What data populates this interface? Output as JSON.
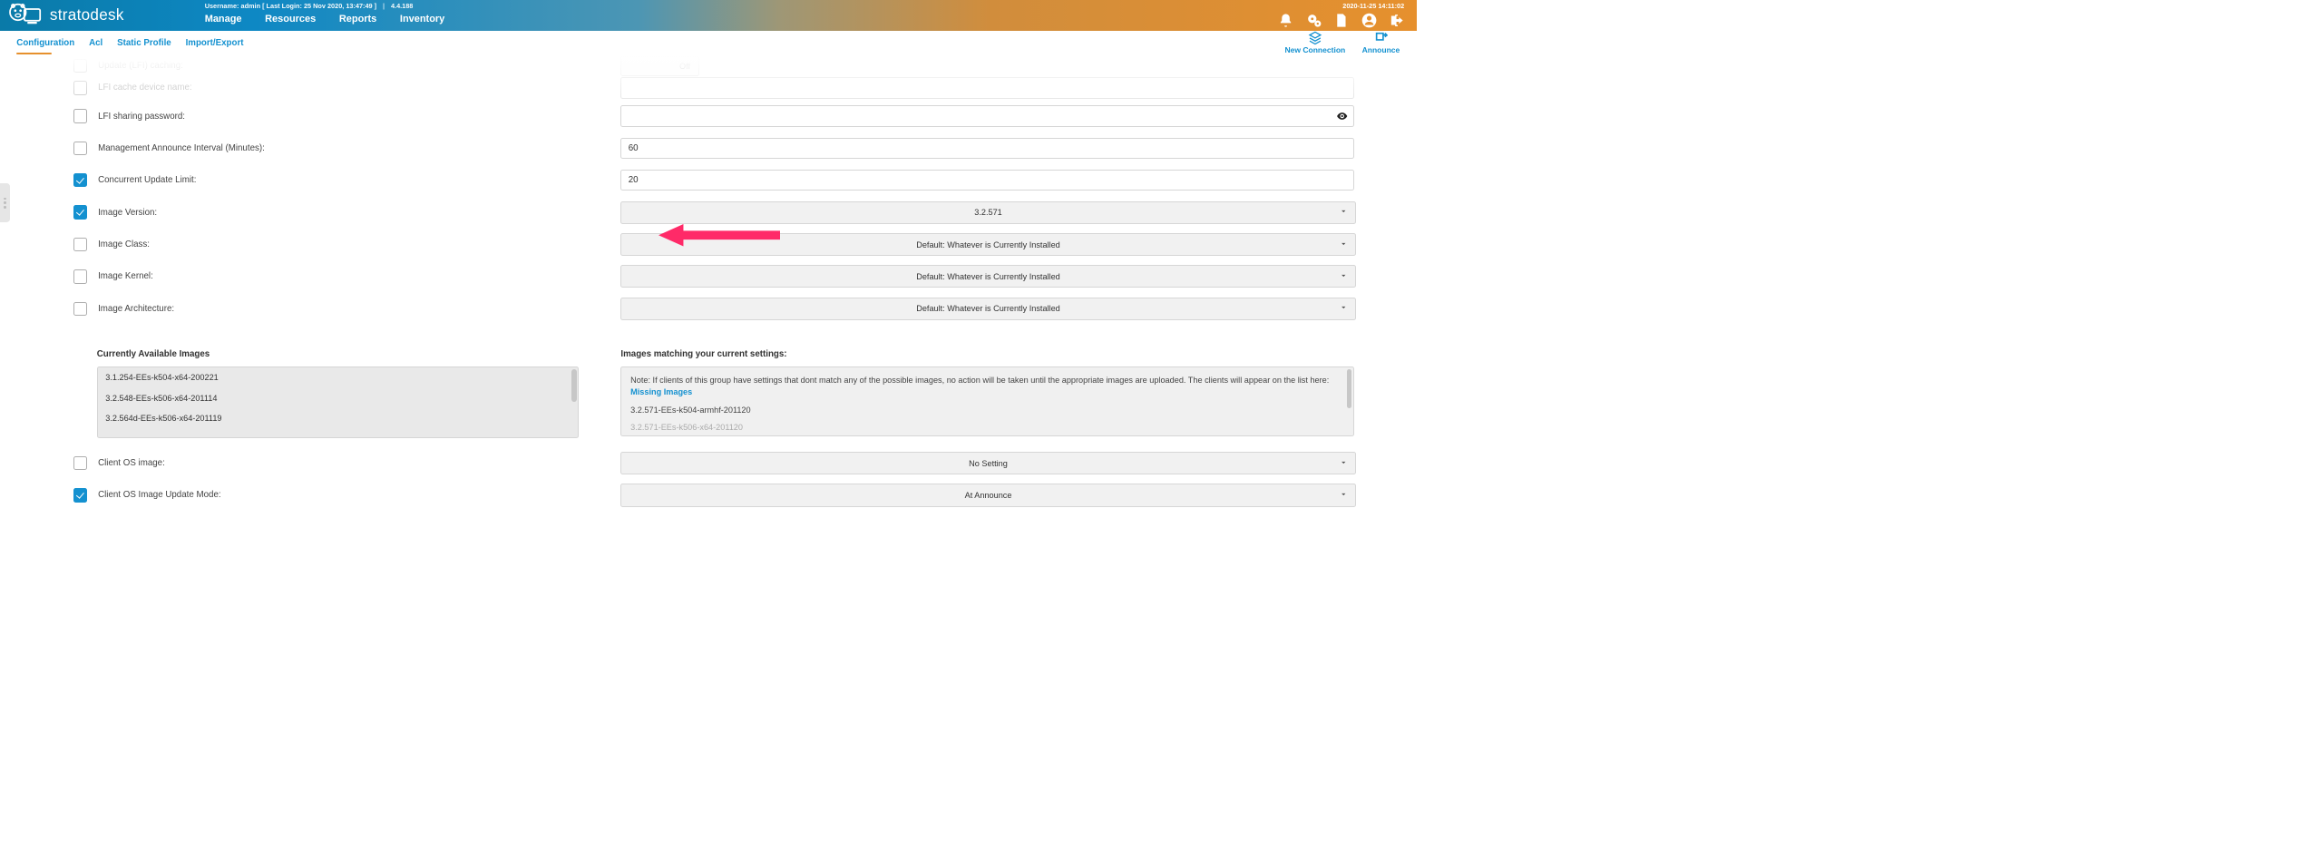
{
  "header": {
    "brand": "stratodesk",
    "username_line": "Username: admin [ Last Login: 25 Nov 2020, 13:47:49 ]",
    "version": "4.4.188",
    "clock": "2020-11-25 14:11:02",
    "nav": {
      "manage": "Manage",
      "resources": "Resources",
      "reports": "Reports",
      "inventory": "Inventory"
    }
  },
  "tabs": {
    "configuration": "Configuration",
    "acl": "Acl",
    "static_profile": "Static Profile",
    "import_export": "Import/Export",
    "new_connection": "New Connection",
    "announce": "Announce"
  },
  "form": {
    "lfi_caching": {
      "label": "Update (LFI) caching:",
      "toggle": "Off"
    },
    "lfi_cache_name": {
      "label": "LFI cache device name:"
    },
    "lfi_password": {
      "label": "LFI sharing password:"
    },
    "announce_interval": {
      "label": "Management Announce Interval (Minutes):",
      "value": "60"
    },
    "concurrent": {
      "label": "Concurrent Update Limit:",
      "value": "20"
    },
    "image_version": {
      "label": "Image Version:",
      "value": "3.2.571"
    },
    "image_class": {
      "label": "Image Class:",
      "value": "Default: Whatever is Currently Installed"
    },
    "image_kernel": {
      "label": "Image Kernel:",
      "value": "Default: Whatever is Currently Installed"
    },
    "image_arch": {
      "label": "Image Architecture:",
      "value": "Default: Whatever is Currently Installed"
    },
    "avail_title": "Currently Available Images",
    "avail_images": [
      "3.1.254-EEs-k504-x64-200221",
      "3.2.548-EEs-k506-x64-201114",
      "3.2.564d-EEs-k506-x64-201119"
    ],
    "match_title": "Images matching your current settings:",
    "note_text": "Note: If clients of this group have settings that dont match any of the possible images, no action will be taken until the appropriate images are uploaded. The clients will appear on the list here: ",
    "note_link": "Missing Images",
    "match1": "3.2.571-EEs-k504-armhf-201120",
    "match2_partial": "3.2.571-EEs-k506-x64-201120",
    "client_os_image": {
      "label": "Client OS image:",
      "value": "No Setting"
    },
    "client_os_mode": {
      "label": "Client OS Image Update Mode:",
      "value": "At Announce"
    }
  }
}
